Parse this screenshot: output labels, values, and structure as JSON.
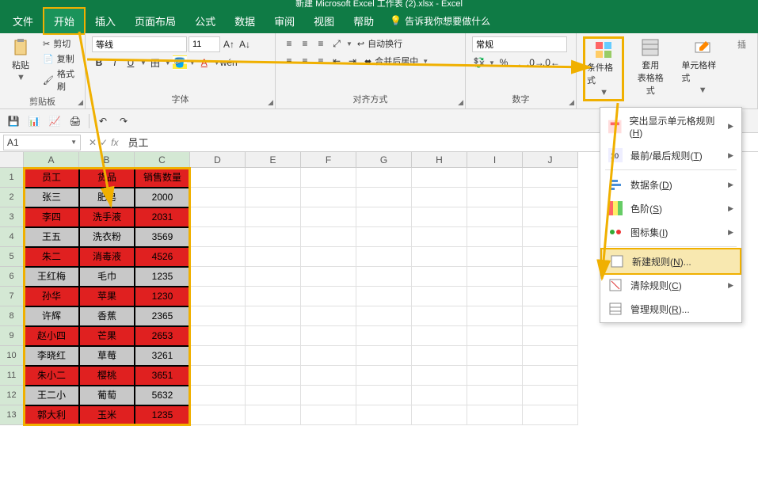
{
  "title": "新建 Microsoft Excel 工作表 (2).xlsx - Excel",
  "menu": {
    "file": "文件",
    "home": "开始",
    "insert": "插入",
    "layout": "页面布局",
    "formulas": "公式",
    "data": "数据",
    "review": "审阅",
    "view": "视图",
    "help": "帮助",
    "tellme": "告诉我你想要做什么"
  },
  "ribbon": {
    "clipboard": {
      "paste": "粘贴",
      "cut": "剪切",
      "copy": "复制",
      "format_painter": "格式刷",
      "label": "剪贴板"
    },
    "font": {
      "name": "等线",
      "size": "11",
      "label": "字体"
    },
    "align": {
      "merge": "合并后居中",
      "wrap": "自动换行",
      "label": "对齐方式"
    },
    "number": {
      "format": "常规",
      "label": "数字"
    },
    "styles": {
      "cond_fmt": "条件格式",
      "table_fmt": "套用\n表格格式",
      "cell_style": "单元格样式"
    }
  },
  "namebox": "A1",
  "formula": "员工",
  "columns": [
    "A",
    "B",
    "C",
    "D",
    "E",
    "F",
    "G",
    "H",
    "I",
    "J"
  ],
  "rows": [
    "1",
    "2",
    "3",
    "4",
    "5",
    "6",
    "7",
    "8",
    "9",
    "10",
    "11",
    "12",
    "13"
  ],
  "table": {
    "header": [
      "员工",
      "货品",
      "销售数量"
    ],
    "rows": [
      {
        "cells": [
          "张三",
          "肥皂",
          "2000"
        ],
        "style": "gray"
      },
      {
        "cells": [
          "李四",
          "洗手液",
          "2031"
        ],
        "style": "red"
      },
      {
        "cells": [
          "王五",
          "洗衣粉",
          "3569"
        ],
        "style": "gray"
      },
      {
        "cells": [
          "朱二",
          "消毒液",
          "4526"
        ],
        "style": "red"
      },
      {
        "cells": [
          "王红梅",
          "毛巾",
          "1235"
        ],
        "style": "gray"
      },
      {
        "cells": [
          "孙华",
          "苹果",
          "1230"
        ],
        "style": "red"
      },
      {
        "cells": [
          "许辉",
          "香蕉",
          "2365"
        ],
        "style": "gray"
      },
      {
        "cells": [
          "赵小四",
          "芒果",
          "2653"
        ],
        "style": "red"
      },
      {
        "cells": [
          "李晓红",
          "草莓",
          "3261"
        ],
        "style": "gray"
      },
      {
        "cells": [
          "朱小二",
          "樱桃",
          "3651"
        ],
        "style": "red"
      },
      {
        "cells": [
          "王二小",
          "葡萄",
          "5632"
        ],
        "style": "gray"
      },
      {
        "cells": [
          "郭大利",
          "玉米",
          "1235"
        ],
        "style": "red"
      }
    ]
  },
  "ctx": {
    "highlight": "突出显示单元格规则",
    "highlight_hot": "H",
    "toprules": "最前/最后规则",
    "toprules_hot": "T",
    "databars": "数据条",
    "databars_hot": "D",
    "colorscales": "色阶",
    "colorscales_hot": "S",
    "iconsets": "图标集",
    "iconsets_hot": "I",
    "newrule": "新建规则",
    "newrule_hot": "N",
    "clear": "清除规则",
    "clear_hot": "C",
    "manage": "管理规则",
    "manage_hot": "R"
  }
}
